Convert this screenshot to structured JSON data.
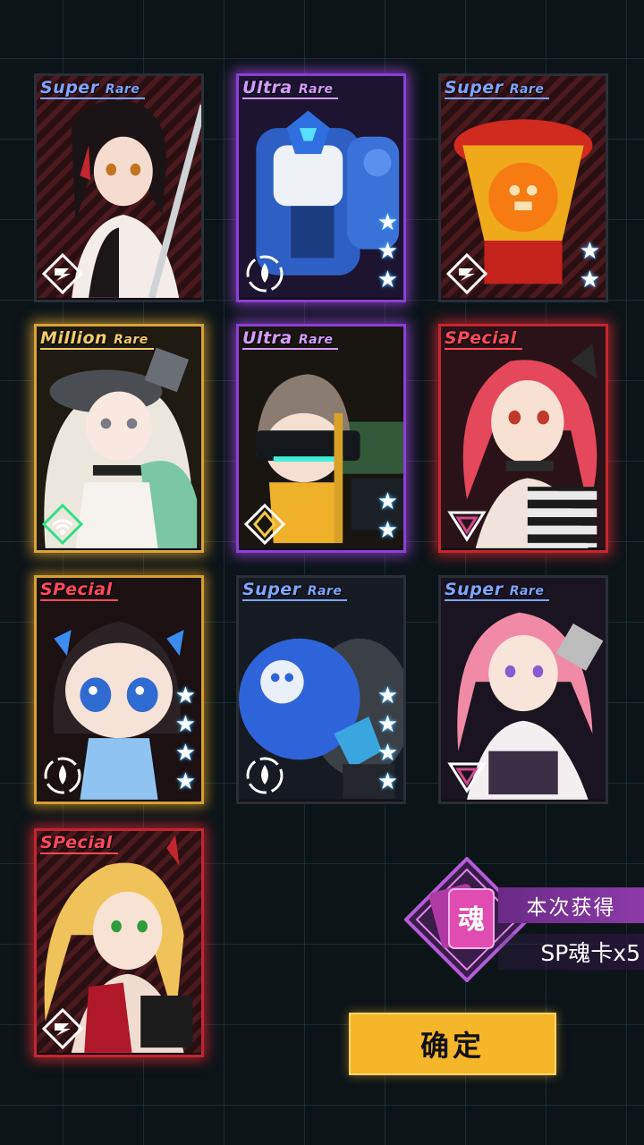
{
  "cards": [
    {
      "rarity_main": "Super",
      "rarity_sub": "Rare",
      "stars": 0,
      "class_icon": "strike-icon",
      "character": "dark-haired-girl-with-spear"
    },
    {
      "rarity_main": "Ultra",
      "rarity_sub": "Rare",
      "stars": 3,
      "class_icon": "water-drop-icon",
      "character": "blue-robot"
    },
    {
      "rarity_main": "Super",
      "rarity_sub": "Rare",
      "stars": 2,
      "class_icon": "strike-icon",
      "character": "yellow-skull-bomb-robot"
    },
    {
      "rarity_main": "Million",
      "rarity_sub": "Rare",
      "stars": 0,
      "class_icon": "signal-icon",
      "character": "white-haired-girl-with-cap"
    },
    {
      "rarity_main": "Ultra",
      "rarity_sub": "Rare",
      "stars": 2,
      "class_icon": "diamond-icon",
      "character": "chibi-visor-girl"
    },
    {
      "rarity_main": "SPecial",
      "rarity_sub": "",
      "stars": 0,
      "class_icon": "triangle-icon",
      "character": "red-twintail-girl"
    },
    {
      "rarity_main": "SPecial",
      "rarity_sub": "",
      "stars": 4,
      "class_icon": "water-drop-icon",
      "character": "chibi-black-haired-girl"
    },
    {
      "rarity_main": "Super",
      "rarity_sub": "Rare",
      "stars": 4,
      "class_icon": "water-drop-icon",
      "character": "blue-skull-bomb"
    },
    {
      "rarity_main": "Super",
      "rarity_sub": "Rare",
      "stars": 0,
      "class_icon": "triangle-icon",
      "character": "pink-haired-girl"
    },
    {
      "rarity_main": "SPecial",
      "rarity_sub": "",
      "stars": 0,
      "class_icon": "strike-icon",
      "character": "blonde-ponytail-girl"
    }
  ],
  "gain": {
    "icon_glyph": "魂",
    "label": "本次获得",
    "value": "SP魂卡x5"
  },
  "confirm_label": "确定",
  "colors": {
    "super": "#7fa4ff",
    "ultra": "#d79bff",
    "million": "#f2cc6a",
    "special": "#ff4a5a",
    "star_glow": "#3fb0ff",
    "button": "#f6b62a"
  }
}
